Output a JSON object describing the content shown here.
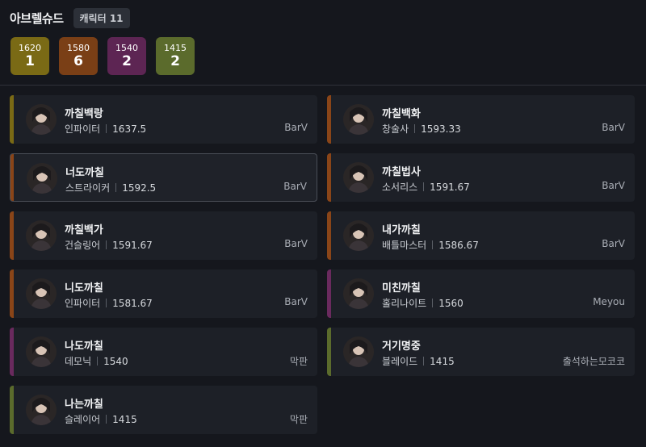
{
  "header": {
    "title": "아브렐슈드",
    "count_label": "캐릭터 11"
  },
  "summary": [
    {
      "level": "1620",
      "count": "1",
      "color": "#7a6a15"
    },
    {
      "level": "1580",
      "count": "6",
      "color": "#7a3f16"
    },
    {
      "level": "1540",
      "count": "2",
      "color": "#5d2553"
    },
    {
      "level": "1415",
      "count": "2",
      "color": "#5b6b2c"
    }
  ],
  "characters": [
    {
      "name": "까칠백랑",
      "class": "인파이터",
      "level": "1637.5",
      "guild": "BarV",
      "tier_color": "#7a6a15"
    },
    {
      "name": "까칠백화",
      "class": "창술사",
      "level": "1593.33",
      "guild": "BarV",
      "tier_color": "#8a4518"
    },
    {
      "name": "너도까칠",
      "class": "스트라이커",
      "level": "1592.5",
      "guild": "BarV",
      "tier_color": "#8a4518"
    },
    {
      "name": "까칠법사",
      "class": "소서리스",
      "level": "1591.67",
      "guild": "BarV",
      "tier_color": "#8a4518"
    },
    {
      "name": "까칠백가",
      "class": "건슬링어",
      "level": "1591.67",
      "guild": "BarV",
      "tier_color": "#8a4518"
    },
    {
      "name": "내가까칠",
      "class": "배틀마스터",
      "level": "1586.67",
      "guild": "BarV",
      "tier_color": "#8a4518"
    },
    {
      "name": "니도까칠",
      "class": "인파이터",
      "level": "1581.67",
      "guild": "BarV",
      "tier_color": "#8a4518"
    },
    {
      "name": "미친까칠",
      "class": "홀리나이트",
      "level": "1560",
      "guild": "Meyou",
      "tier_color": "#6a2a5e"
    },
    {
      "name": "나도까칠",
      "class": "데모닉",
      "level": "1540",
      "guild": "막판",
      "tier_color": "#6a2a5e"
    },
    {
      "name": "거기명중",
      "class": "블레이드",
      "level": "1415",
      "guild": "출석하는모코코",
      "tier_color": "#5b6b2c"
    },
    {
      "name": "나는까칠",
      "class": "슬레이어",
      "level": "1415",
      "guild": "막판",
      "tier_color": "#5b6b2c"
    }
  ],
  "selected_index": 2
}
